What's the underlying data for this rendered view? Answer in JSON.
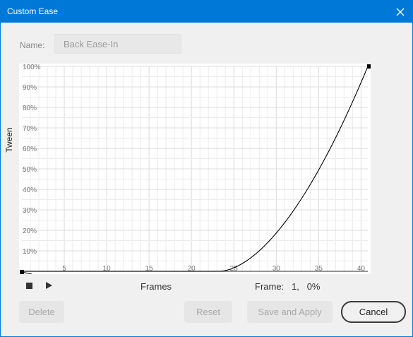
{
  "window": {
    "title": "Custom Ease"
  },
  "name_field": {
    "label": "Name:",
    "value": "Back Ease-In"
  },
  "graph": {
    "y_axis_label": "Tween",
    "x_axis_label": "Frames",
    "y_ticks": [
      "10%",
      "20%",
      "30%",
      "40%",
      "50%",
      "60%",
      "70%",
      "80%",
      "90%",
      "100%"
    ],
    "x_ticks": [
      "5",
      "10",
      "15",
      "20",
      "25",
      "30",
      "35",
      "40"
    ],
    "grid_color": "#e0e0e0",
    "curve_color": "#000000"
  },
  "frame_readout": {
    "label": "Frame:",
    "frame": "1,",
    "value": "0%"
  },
  "buttons": {
    "delete": "Delete",
    "reset": "Reset",
    "save_apply": "Save and Apply",
    "cancel": "Cancel"
  },
  "colors": {
    "title_bar": "#0078d7",
    "background": "#f0f0f0"
  }
}
